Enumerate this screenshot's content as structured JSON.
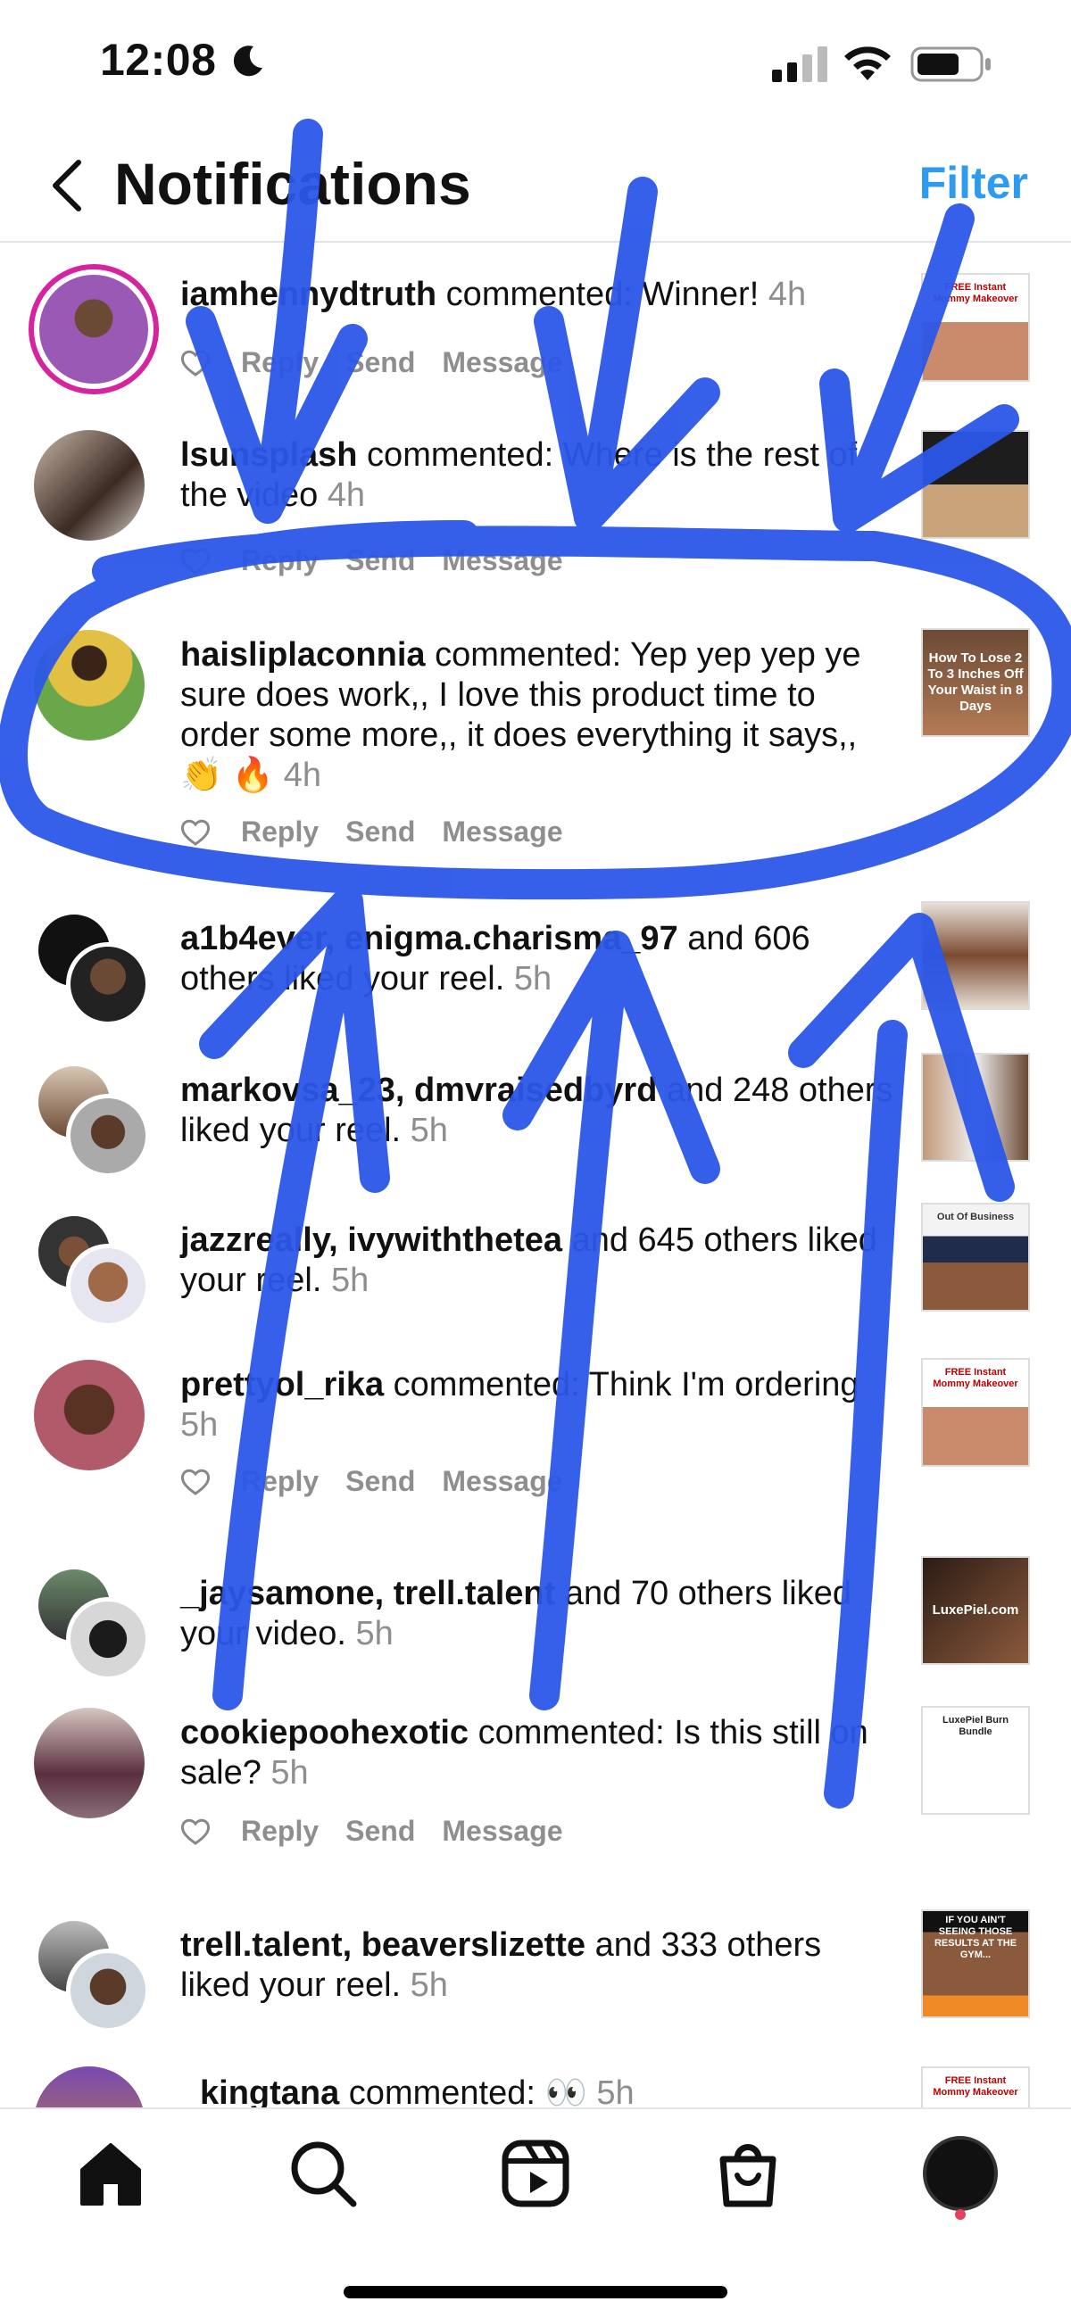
{
  "status_bar": {
    "time": "12:08",
    "icons": [
      "moon-icon",
      "signal-icon",
      "wifi-icon",
      "battery-icon"
    ]
  },
  "header": {
    "title": "Notifications",
    "filter_label": "Filter"
  },
  "actions": {
    "reply": "Reply",
    "send": "Send",
    "message": "Message"
  },
  "notifications": [
    {
      "user": "iamhennydtruth",
      "text": " commented: Winner! ",
      "time": "4h",
      "has_actions": true
    },
    {
      "user": "lsunsplash",
      "text": " commented: Where is the rest of the video ",
      "time": "4h",
      "has_actions": true
    },
    {
      "user": "haisliplaconnia",
      "text": " commented: Yep yep yep ye sure does work,, I love this product time to order some more,, it does everything it says,, 👏 🔥 ",
      "time": "4h",
      "has_actions": true,
      "thumb_caption": "How To Lose 2 To 3 Inches Off Your Waist in 8 Days"
    },
    {
      "user": "a1b4ever, enigma.charisma_97",
      "text": " and 606 others liked your reel. ",
      "time": "5h",
      "has_actions": false
    },
    {
      "user": "markovsa_23, dmvraisedbyrd",
      "text": " and 248 others liked your reel. ",
      "time": "5h",
      "has_actions": false
    },
    {
      "user": "jazzreally, ivywiththetea",
      "text": " and 645 others liked your reel. ",
      "time": "5h",
      "has_actions": false,
      "thumb_caption": "Out Of Business"
    },
    {
      "user": "prettyol_rika",
      "text": " commented: Think I'm ordering ",
      "time": "5h",
      "has_actions": true,
      "thumb_caption": "FREE Instant Mommy Makeover"
    },
    {
      "user": "_jaysamone, trell.talent",
      "text": " and 70 others liked your video. ",
      "time": "5h",
      "has_actions": false,
      "thumb_caption": "LuxePiel.com"
    },
    {
      "user": "cookiepoohexotic",
      "text": " commented: Is this still on sale? ",
      "time": "5h",
      "has_actions": true,
      "thumb_caption": "LuxePiel Burn Bundle"
    },
    {
      "user": "trell.talent, beaverslizette",
      "text": " and 333 others liked your reel. ",
      "time": "5h",
      "has_actions": false,
      "thumb_caption": "IF YOU AIN'T SEEING THOSE RESULTS AT THE GYM..."
    },
    {
      "user": "kingtana",
      "text": " commented: 👀 ",
      "time": "5h",
      "has_actions": false,
      "thumb_caption": "FREE Instant Mommy Makeover"
    }
  ],
  "first_thumb_caption": "FREE Instant Mommy Makeover",
  "tab_bar": {
    "tabs": [
      "home-icon",
      "search-icon",
      "reels-icon",
      "shop-icon",
      "profile-avatar"
    ]
  },
  "colors": {
    "accent": "#2f9bf0",
    "scribble": "#2b57e8",
    "story_ring": "#d6249f"
  }
}
